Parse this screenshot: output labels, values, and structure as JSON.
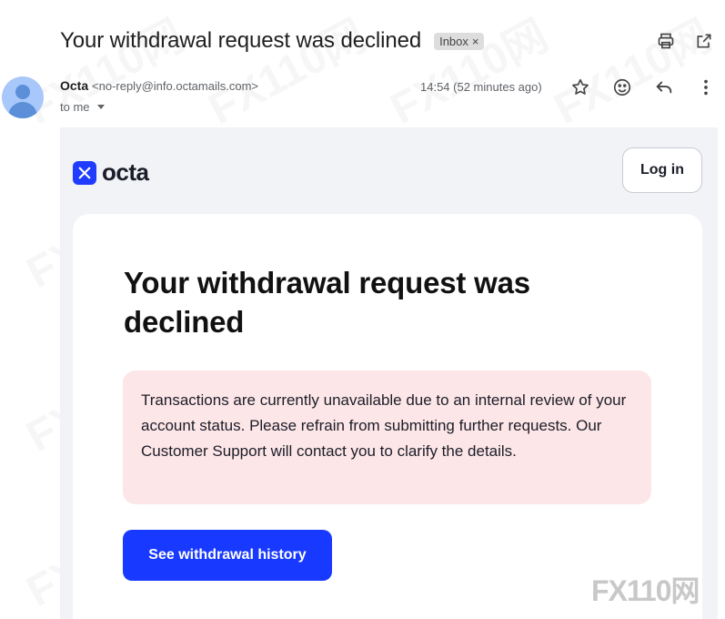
{
  "email": {
    "subject": "Your withdrawal request was declined",
    "label": "Inbox",
    "label_remove": "×",
    "sender_name": "Octa",
    "sender_email": "<no-reply@info.octamails.com>",
    "recipient": "to me",
    "time": "14:54 (52 minutes ago)"
  },
  "icons": {
    "print": "print-icon",
    "open_new_window": "open-in-new-window-icon",
    "star": "star-icon",
    "emoji": "emoji-reaction-icon",
    "reply": "reply-icon",
    "more": "more-vertical-icon",
    "caret": "chevron-down-icon"
  },
  "body": {
    "brand_name": "octa",
    "login_label": "Log in",
    "headline": "Your withdrawal request was declined",
    "message": "Transactions are currently unavailable due to an internal review of your account status. Please refrain from submitting further requests. Our Customer Support will contact you to clarify the details.",
    "cta_label": "See withdrawal history"
  },
  "watermark": {
    "text": "FX110网"
  },
  "colors": {
    "brand_blue": "#1839ff",
    "alert_bg": "#fde6e7",
    "frame_bg": "#f1f3f6",
    "avatar_bg": "#a8c7fa"
  }
}
